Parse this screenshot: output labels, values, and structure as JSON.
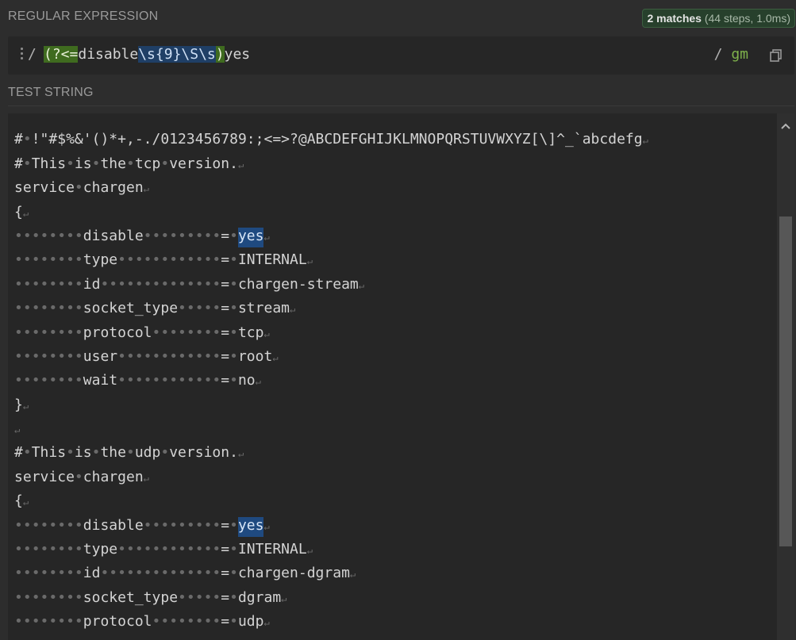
{
  "regex_section": {
    "title": "REGULAR EXPRESSION",
    "match_count": "2 matches",
    "match_detail": "(44 steps, 1.0ms)",
    "open_delimiter": "/",
    "pattern_parts": {
      "lookbehind_open": "(?<=",
      "literal": "disable",
      "esc1": "\\s{9}",
      "esc2": "\\S",
      "esc3": "\\s",
      "close": ")",
      "tail": "yes"
    },
    "close_delimiter": "/",
    "flags": "gm"
  },
  "test_section": {
    "title": "TEST STRING",
    "lines": [
      "# !\"#$%&'()*+,-./0123456789:;<=>?@ABCDEFGHIJKLMNOPQRSTUVWXYZ[\\]^_`abcdefg",
      "# This is the tcp version.",
      "service chargen",
      "{",
      "        disable         = yes",
      "        type            = INTERNAL",
      "        id              = chargen-stream",
      "        socket_type     = stream",
      "        protocol        = tcp",
      "        user            = root",
      "        wait            = no",
      "}",
      "",
      "# This is the udp version.",
      "service chargen",
      "{",
      "        disable         = yes",
      "        type            = INTERNAL",
      "        id              = chargen-dgram",
      "        socket_type     = dgram",
      "        protocol        = udp"
    ],
    "highlighted_match": "yes"
  },
  "colors": {
    "background": "#2d2d2d",
    "editor_background": "#262626",
    "lookbehind_group": "#3f6b1f",
    "escape_token": "#1f3f66",
    "match_highlight": "#1f4a80",
    "flag_color": "#7fb24c"
  },
  "icons": {
    "menu": "vertical-dots-icon",
    "copy": "copy-icon",
    "scroll_up": "chevron-up-icon"
  }
}
